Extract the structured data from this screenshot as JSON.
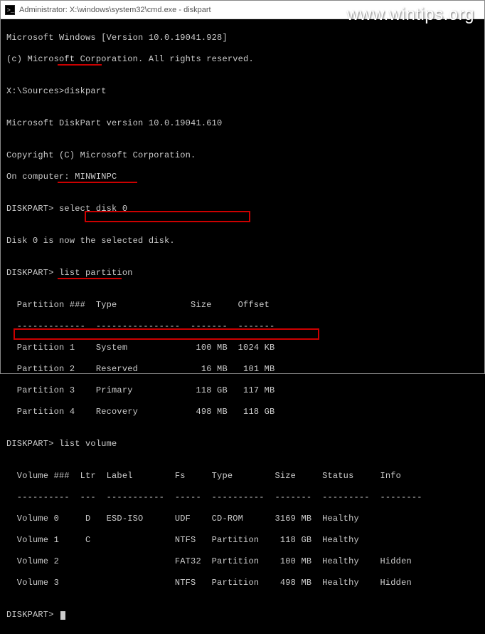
{
  "titlebar": {
    "text": "Administrator: X:\\windows\\system32\\cmd.exe - diskpart"
  },
  "watermark": "www.wintips.org",
  "lines": {
    "l1": "Microsoft Windows [Version 10.0.19041.928]",
    "l2": "(c) Microsoft Corporation. All rights reserved.",
    "l3": "",
    "l4": "X:\\Sources>diskpart",
    "l5": "",
    "l6": "Microsoft DiskPart version 10.0.19041.610",
    "l7": "",
    "l8": "Copyright (C) Microsoft Corporation.",
    "l9": "On computer: MINWINPC",
    "l10": "",
    "l11": "DISKPART> select disk 0",
    "l12": "",
    "l13": "Disk 0 is now the selected disk.",
    "l14": "",
    "l15": "DISKPART> list partition",
    "l16": "",
    "l17": "  Partition ###  Type              Size     Offset",
    "l18": "  -------------  ----------------  -------  -------",
    "l19": "  Partition 1    System             100 MB  1024 KB",
    "l20": "  Partition 2    Reserved            16 MB   101 MB",
    "l21": "  Partition 3    Primary            118 GB   117 MB",
    "l22": "  Partition 4    Recovery           498 MB   118 GB",
    "l23": "",
    "l24": "DISKPART> list volume",
    "l25": "",
    "l26": "  Volume ###  Ltr  Label        Fs     Type        Size     Status     Info",
    "l27": "  ----------  ---  -----------  -----  ----------  -------  ---------  --------",
    "l28": "  Volume 0     D   ESD-ISO      UDF    CD-ROM      3169 MB  Healthy",
    "l29": "  Volume 1     C                NTFS   Partition    118 GB  Healthy",
    "l30": "  Volume 2                      FAT32  Partition    100 MB  Healthy    Hidden",
    "l31": "  Volume 3                      NTFS   Partition    498 MB  Healthy    Hidden",
    "l32": "",
    "l33": "DISKPART> "
  }
}
